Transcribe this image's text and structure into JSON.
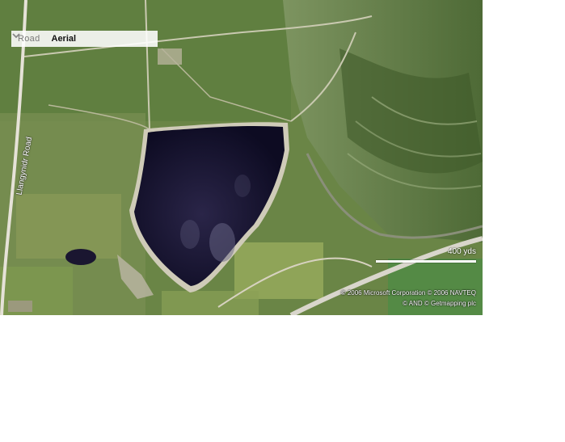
{
  "map_type_selector": {
    "road_label": "Road",
    "aerial_label": "Aerial",
    "selected": "Aerial"
  },
  "map": {
    "road_name": "Llangynidr Road",
    "scale_label": "400 yds",
    "copyright_line1": "© 2006 Microsoft Corporation  © 2006 NAVTEQ",
    "copyright_line2": "© AND  © Getmapping plc"
  },
  "colors": {
    "water": "#120f2a",
    "grass": "#6f8a48",
    "selected_mode_text": "#111111",
    "unselected_mode_text": "#7a7a7a"
  }
}
